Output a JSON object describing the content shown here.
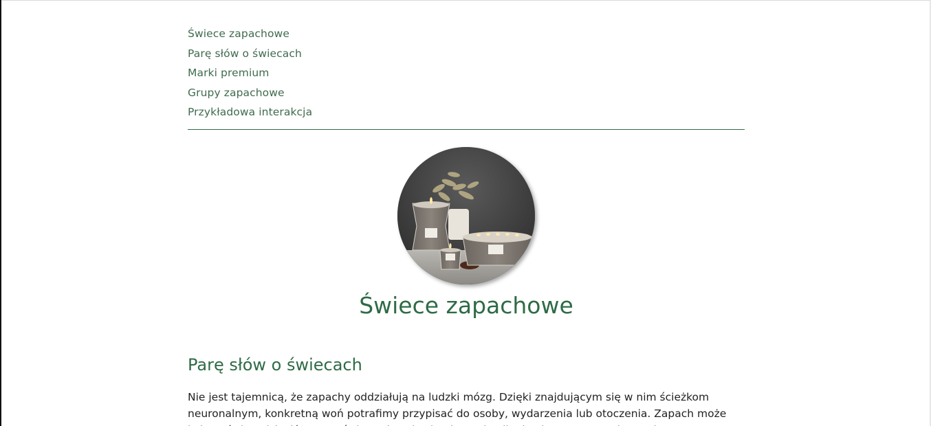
{
  "nav": {
    "items": [
      {
        "label": "Świece zapachowe"
      },
      {
        "label": "Parę słów o świecach"
      },
      {
        "label": "Marki premium"
      },
      {
        "label": "Grupy zapachowe"
      },
      {
        "label": "Przykładowa interakcja"
      }
    ]
  },
  "hero": {
    "title": "Świece zapachowe",
    "image_alt": "Świece zapachowe"
  },
  "section": {
    "title": "Parę słów o świecach",
    "paragraph": "Nie jest tajemnicą, że zapachy oddziałują na ludzki mózg. Dzięki znajdującym się w nim ścieżkom neuronalnym, konkretną woń potrafimy przypisać do osoby, wydarzenia lub otoczenia. Zapach może kojarzyć się z dzieciństwem, świętami, wakacjami czy chociby konkretną porą roku. Może"
  },
  "colors": {
    "accent": "#2e6b46",
    "nav_text": "#3f6b4e",
    "body_text": "#222222"
  }
}
